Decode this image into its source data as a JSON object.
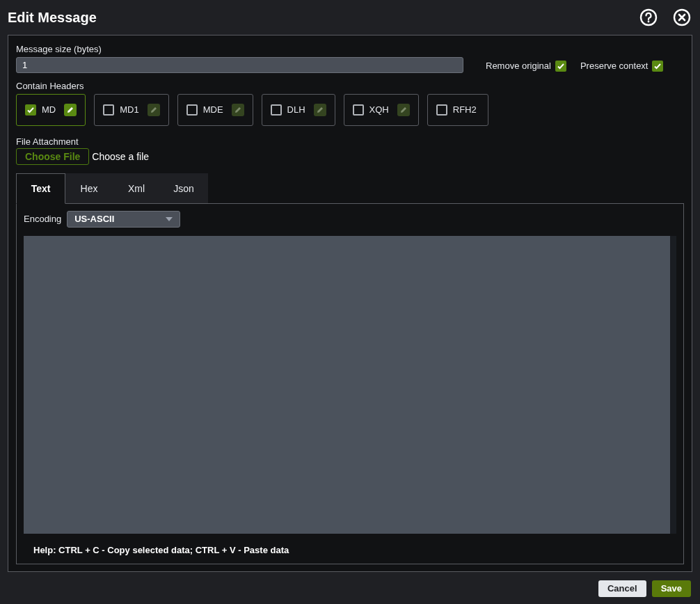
{
  "window": {
    "title": "Edit Message"
  },
  "message_size": {
    "label": "Message size (bytes)",
    "value": "1"
  },
  "options": [
    {
      "label": "Remove original",
      "checked": true
    },
    {
      "label": "Preserve context",
      "checked": true
    }
  ],
  "headers": {
    "label": "Contain Headers",
    "items": [
      {
        "label": "MD",
        "checked": true,
        "editable": true
      },
      {
        "label": "MD1",
        "checked": false,
        "editable": true
      },
      {
        "label": "MDE",
        "checked": false,
        "editable": true
      },
      {
        "label": "DLH",
        "checked": false,
        "editable": true
      },
      {
        "label": "XQH",
        "checked": false,
        "editable": true
      },
      {
        "label": "RFH2",
        "checked": false,
        "editable": false
      }
    ]
  },
  "file_attachment": {
    "label": "File Attachment",
    "button": "Choose File",
    "status": "Choose a file"
  },
  "tabs": [
    {
      "label": "Text",
      "selected": true
    },
    {
      "label": "Hex",
      "selected": false
    },
    {
      "label": "Xml",
      "selected": false
    },
    {
      "label": "Json",
      "selected": false
    }
  ],
  "encoding": {
    "label": "Encoding",
    "value": "US-ASCII"
  },
  "help": "Help: CTRL + C - Copy selected data; CTRL + V - Paste data",
  "buttons": [
    {
      "label": "Cancel",
      "kind": "secondary"
    },
    {
      "label": "Save",
      "kind": "primary"
    }
  ]
}
